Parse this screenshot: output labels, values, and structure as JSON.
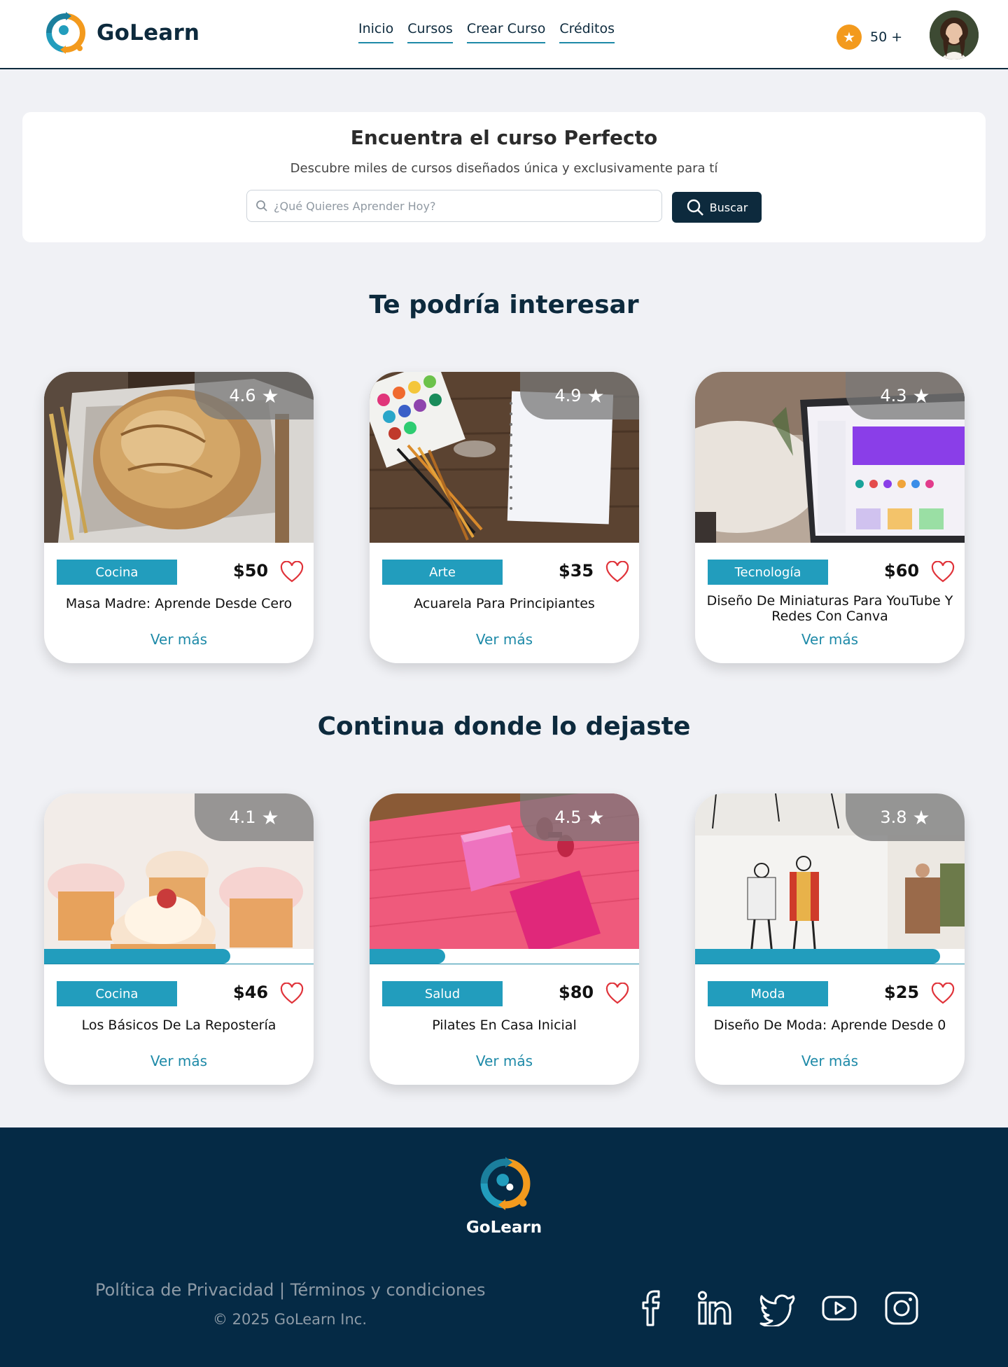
{
  "brand": {
    "name": "GoLearn"
  },
  "nav": {
    "items": [
      {
        "label": "Inicio"
      },
      {
        "label": "Cursos"
      },
      {
        "label": "Crear Curso"
      },
      {
        "label": "Créditos"
      }
    ]
  },
  "credits": {
    "count": "50 +"
  },
  "search": {
    "title": "Encuentra el curso Perfecto",
    "subtitle": "Descubre miles de cursos diseñados única y exclusivamente para tí",
    "placeholder": "¿Qué Quieres Aprender Hoy?",
    "button_label": "Buscar"
  },
  "recommended": {
    "title": "Te podría interesar",
    "courses": [
      {
        "rating": "4.6",
        "category": "Cocina",
        "price": "$50",
        "title": "Masa Madre: Aprende Desde Cero",
        "link": "Ver más"
      },
      {
        "rating": "4.9",
        "category": "Arte",
        "price": "$35",
        "title": "Acuarela Para Principiantes",
        "link": "Ver más"
      },
      {
        "rating": "4.3",
        "category": "Tecnología",
        "price": "$60",
        "title": "Diseño De Miniaturas Para YouTube Y Redes Con Canva",
        "link": "Ver más"
      }
    ]
  },
  "continue": {
    "title": "Continua donde lo dejaste",
    "courses": [
      {
        "rating": "4.1",
        "category": "Cocina",
        "price": "$46",
        "title": "Los Básicos De La Repostería",
        "link": "Ver más",
        "progress": 0.69
      },
      {
        "rating": "4.5",
        "category": "Salud",
        "price": "$80",
        "title": "Pilates En Casa Inicial",
        "link": "Ver más",
        "progress": 0.28
      },
      {
        "rating": "3.8",
        "category": "Moda",
        "price": "$25",
        "title": "Diseño De Moda: Aprende Desde 0",
        "link": "Ver más",
        "progress": 0.91
      }
    ]
  },
  "footer": {
    "brand": "GoLearn",
    "privacy": "Política de Privacidad",
    "separator": " | ",
    "terms": "Términos y condiciones",
    "copyright": "© 2025 GoLearn Inc.",
    "socials": [
      "facebook-icon",
      "linkedin-icon",
      "twitter-icon",
      "youtube-icon",
      "instagram-icon"
    ]
  },
  "colors": {
    "navy": "#0d2a3d",
    "teal": "#229dbd",
    "orange": "#f39a1d",
    "footer_bg": "#052a45",
    "heart": "#e0333a"
  }
}
